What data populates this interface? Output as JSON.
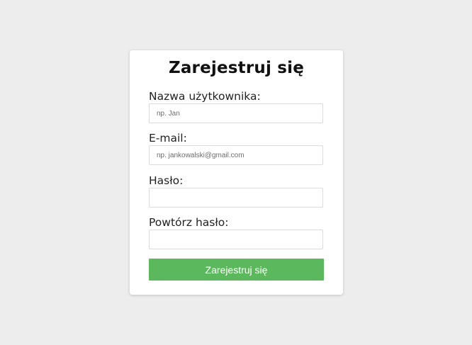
{
  "form": {
    "title": "Zarejestruj się",
    "fields": [
      {
        "label": "Nazwa użytkownika:",
        "placeholder": "np. Jan",
        "value": ""
      },
      {
        "label": "E-mail:",
        "placeholder": "np. jankowalski@gmail.com",
        "value": ""
      },
      {
        "label": "Hasło:",
        "placeholder": "",
        "value": ""
      },
      {
        "label": "Powtórz hasło:",
        "placeholder": "",
        "value": ""
      }
    ],
    "submit_label": "Zarejestruj się"
  },
  "colors": {
    "background": "#ededed",
    "card": "#ffffff",
    "button": "#5cb85c",
    "button_text": "#ffffff"
  }
}
